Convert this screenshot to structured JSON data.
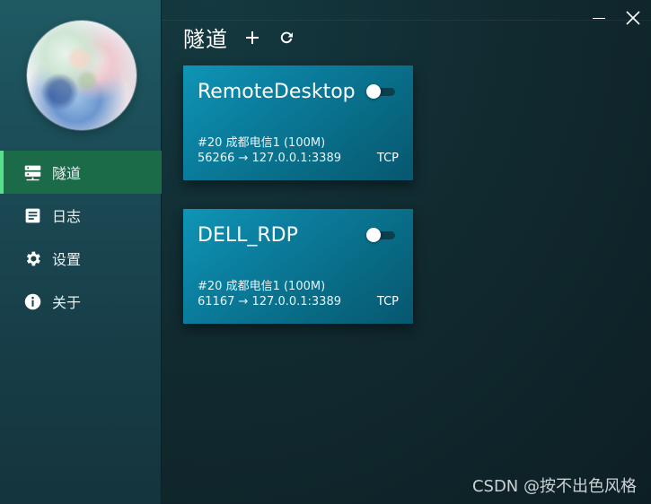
{
  "sidebar": {
    "avatar_label": "avatar",
    "items": [
      {
        "label": "隧道",
        "icon": "server-icon",
        "active": true
      },
      {
        "label": "日志",
        "icon": "document-icon",
        "active": false
      },
      {
        "label": "设置",
        "icon": "gear-icon",
        "active": false
      },
      {
        "label": "关于",
        "icon": "info-icon",
        "active": false
      }
    ]
  },
  "header": {
    "title": "隧道",
    "add_icon": "plus-icon",
    "refresh_icon": "refresh-icon"
  },
  "window": {
    "minimize_icon": "minimize-icon",
    "close_icon": "close-icon"
  },
  "tunnels": [
    {
      "name": "RemoteDesktop",
      "node": "#20 成都电信1 (100M)",
      "mapping": "56266 → 127.0.0.1:3389",
      "protocol": "TCP",
      "enabled": false
    },
    {
      "name": "DELL_RDP",
      "node": "#20 成都电信1 (100M)",
      "mapping": "61167 → 127.0.0.1:3389",
      "protocol": "TCP",
      "enabled": false
    }
  ],
  "watermark": "CSDN @按不出色风格",
  "colors": {
    "sidebar_active": "#1b6b48",
    "active_indicator": "#58e08c",
    "card": "#0b7d9d"
  }
}
